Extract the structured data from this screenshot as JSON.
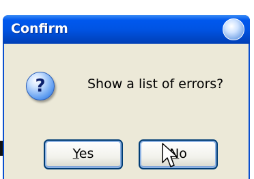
{
  "dialog": {
    "title": "Confirm",
    "message": "Show a list of errors?",
    "icon": "question-icon"
  },
  "buttons": {
    "yes": {
      "mnemonic": "Y",
      "rest": "es"
    },
    "no": {
      "mnemonic": "N",
      "rest": "o"
    }
  }
}
